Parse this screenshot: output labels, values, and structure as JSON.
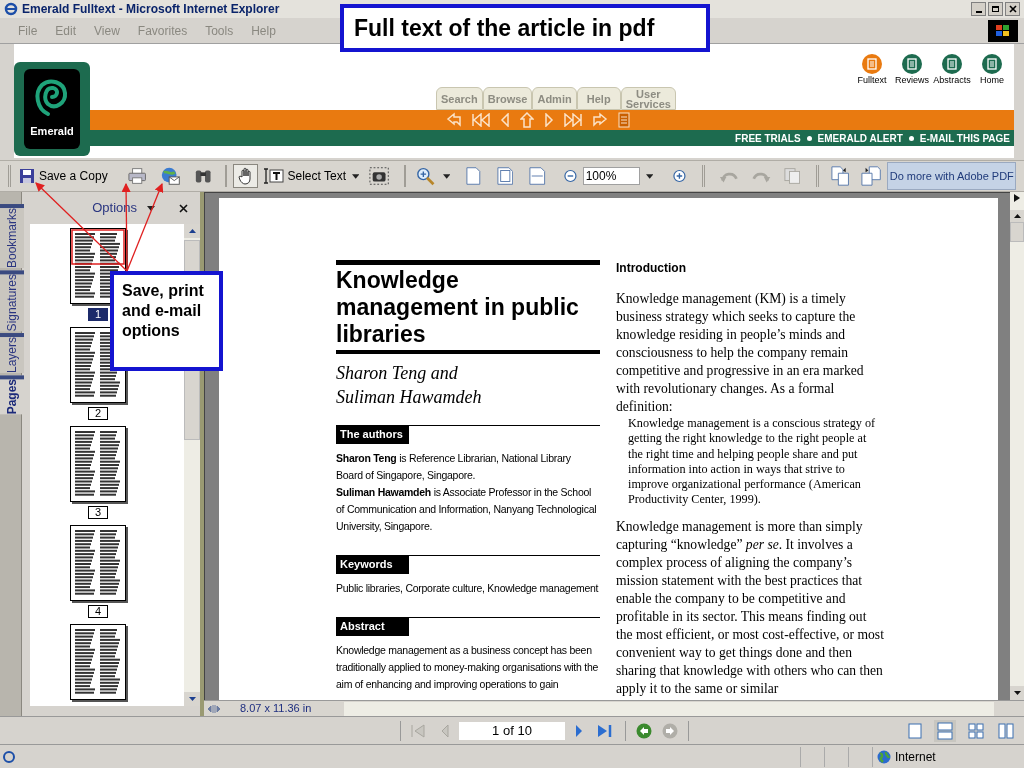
{
  "window": {
    "title": "Emerald Fulltext - Microsoft Internet Explorer"
  },
  "menu": [
    "File",
    "Edit",
    "View",
    "Favorites",
    "Tools",
    "Help"
  ],
  "callouts": [
    {
      "text": "Full text of the article in pdf"
    },
    {
      "text": "Save, print and e-mail options"
    }
  ],
  "site": {
    "logo_text": "Emerald",
    "quick_links": [
      "Fulltext",
      "Reviews",
      "Abstracts",
      "Home"
    ],
    "tabs": [
      "Search",
      "Browse",
      "Admin",
      "Help",
      "User Services"
    ],
    "alert_links": [
      "FREE TRIALS",
      "EMERALD ALERT",
      "E-MAIL THIS PAGE"
    ]
  },
  "toolbar": {
    "save": "Save a Copy",
    "select": "Select Text",
    "zoom": "100%",
    "promo": "Do more with Adobe PDF"
  },
  "side_tabs": [
    {
      "label": "Bookmarks",
      "selected": false
    },
    {
      "label": "Signatures",
      "selected": false
    },
    {
      "label": "Layers",
      "selected": false
    },
    {
      "label": "Pages",
      "selected": true
    }
  ],
  "panel": {
    "options": "Options"
  },
  "thumbnails": [
    {
      "label": "1",
      "selected": true
    },
    {
      "label": "2",
      "selected": false
    },
    {
      "label": "3",
      "selected": false
    },
    {
      "label": "4",
      "selected": false
    },
    {
      "selected": false
    }
  ],
  "article": {
    "title": "Knowledge management in public libraries",
    "authors": [
      "Sharon Teng and",
      "Suliman Hawamdeh"
    ],
    "sections": [
      {
        "heading": "The authors",
        "paragraphs": [
          "**Sharon Teng** is Reference Librarian, National Library Board of Singapore, Singapore.",
          "**Suliman Hawamdeh** is Associate Professor in the School of Communication and Information, Nanyang Technological University, Singapore."
        ]
      },
      {
        "heading": "Keywords",
        "paragraphs": [
          "Public libraries, Corporate culture, Knowledge management"
        ]
      },
      {
        "heading": "Abstract",
        "paragraphs": [
          "Knowledge management as a business concept has been traditionally applied to money-making organisations with the aim of enhancing and improving operations to gain"
        ]
      }
    ],
    "intro_heading": "Introduction",
    "intro": [
      {
        "kind": "paragraph",
        "text": "Knowledge management (KM) is a timely business strategy which seeks to capture the knowledge residing in people’s minds and consciousness to help the company remain competitive and progressive in an era marked with revolutionary changes. As a formal definition:"
      },
      {
        "kind": "quote",
        "text": "Knowledge management is a conscious strategy of getting the right knowledge to the right people at the right time and helping people share and put information into action in ways that strive to improve organizational performance (American Productivity Center, 1999)."
      },
      {
        "kind": "paragraph",
        "text": "Knowledge management is more than simply capturing “knowledge” *per se*. It involves a complex process of aligning the company’s mission statement with the best practices that enable the company to be competitive and profitable in its sector. This means finding out the most efficient, or most cost-effective, or most convenient way to get things done and then sharing that knowledge with others who can then apply it to the same or similar"
      }
    ]
  },
  "page_size": "8.07 x 11.36 in",
  "page_field": "1 of 10",
  "status_zone": "Internet"
}
